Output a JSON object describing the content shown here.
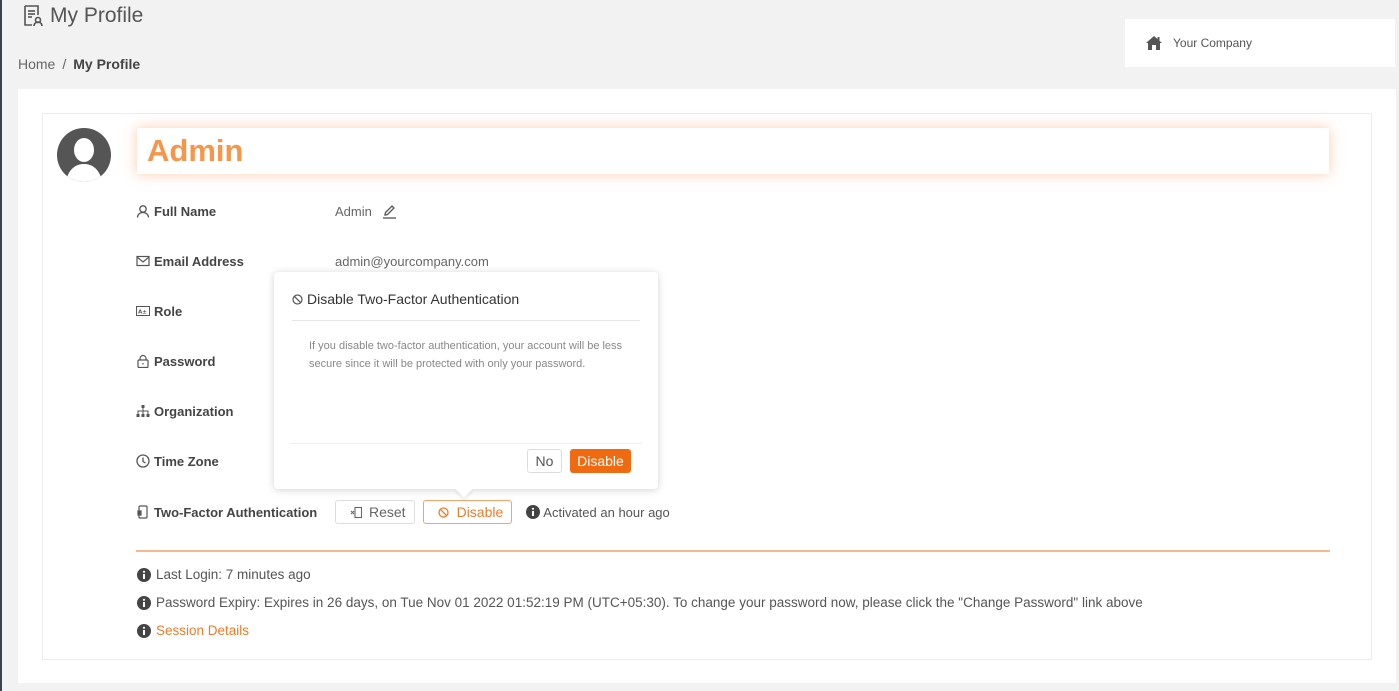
{
  "header": {
    "title": "My Profile",
    "title_icon": "profile-document-icon"
  },
  "breadcrumb": {
    "home": "Home",
    "separator": "/",
    "current": "My Profile"
  },
  "company": {
    "icon": "home-icon",
    "name": "Your Company"
  },
  "profile": {
    "display_name": "Admin",
    "avatar_icon": "user-avatar-icon",
    "fields": [
      {
        "icon": "user-icon",
        "label": "Full Name",
        "value": "Admin",
        "editable": true
      },
      {
        "icon": "envelope-icon",
        "label": "Email Address",
        "value": "admin@yourcompany.com"
      },
      {
        "icon": "id-card-icon",
        "label": "Role",
        "value": ""
      },
      {
        "icon": "lock-icon",
        "label": "Password",
        "value": ""
      },
      {
        "icon": "sitemap-icon",
        "label": "Organization",
        "value": ""
      },
      {
        "icon": "clock-icon",
        "label": "Time Zone",
        "value": ""
      },
      {
        "icon": "mobile-icon",
        "label": "Two-Factor Authentication",
        "value": ""
      }
    ],
    "two_factor": {
      "reset_label": "Reset",
      "disable_label": "Disable",
      "status": "Activated an hour ago"
    }
  },
  "meta": {
    "last_login": "Last Login: 7 minutes ago",
    "password_expiry": "Password Expiry: Expires in 26 days, on Tue Nov 01 2022 01:52:19 PM (UTC+05:30). To change your password now, please click the \"Change Password\" link above",
    "session_details": "Session Details"
  },
  "popover": {
    "title": "Disable Two-Factor Authentication",
    "body": "If you disable two-factor authentication, your account will be less secure since it will be protected with only your password.",
    "no_label": "No",
    "confirm_label": "Disable"
  },
  "colors": {
    "accent": "#f06a12",
    "accent_light": "#f7954a",
    "divider": "#f6b98e"
  }
}
